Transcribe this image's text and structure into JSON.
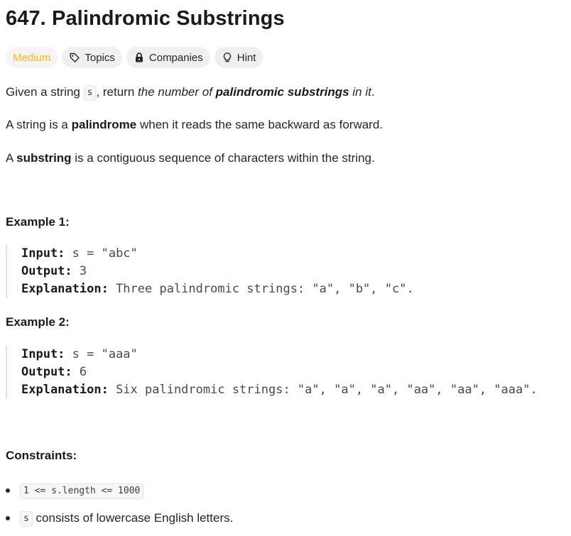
{
  "problem": {
    "title": "647. Palindromic Substrings"
  },
  "tags": {
    "difficulty": "Medium",
    "topics": "Topics",
    "companies": "Companies",
    "hint": "Hint"
  },
  "description": {
    "p1_pre": "Given a string ",
    "p1_code": "s",
    "p1_mid": ", return ",
    "p1_italic1": "the number of ",
    "p1_bold": "palindromic substrings",
    "p1_italic2": " in it",
    "p1_end": ".",
    "p2_pre": "A string is a ",
    "p2_bold": "palindrome",
    "p2_post": " when it reads the same backward as forward.",
    "p3_pre": "A ",
    "p3_bold": "substring",
    "p3_post": " is a contiguous sequence of characters within the string."
  },
  "examples": [
    {
      "heading": "Example 1:",
      "input_label": "Input:",
      "input_value": " s = \"abc\"",
      "output_label": "Output:",
      "output_value": " 3",
      "explanation_label": "Explanation:",
      "explanation_value": " Three palindromic strings: \"a\", \"b\", \"c\"."
    },
    {
      "heading": "Example 2:",
      "input_label": "Input:",
      "input_value": " s = \"aaa\"",
      "output_label": "Output:",
      "output_value": " 6",
      "explanation_label": "Explanation:",
      "explanation_value": " Six palindromic strings: \"a\", \"a\", \"a\", \"aa\", \"aa\", \"aaa\"."
    }
  ],
  "constraints": {
    "heading": "Constraints:",
    "c1_code": "1 <= s.length <= 1000",
    "c2_code": "s",
    "c2_text": " consists of lowercase English letters."
  },
  "icons": {
    "topics": "tag-icon",
    "companies": "lock-icon",
    "hint": "lightbulb-icon"
  },
  "colors": {
    "medium": "#ffb800",
    "tag_bg": "#f0f0f0"
  }
}
